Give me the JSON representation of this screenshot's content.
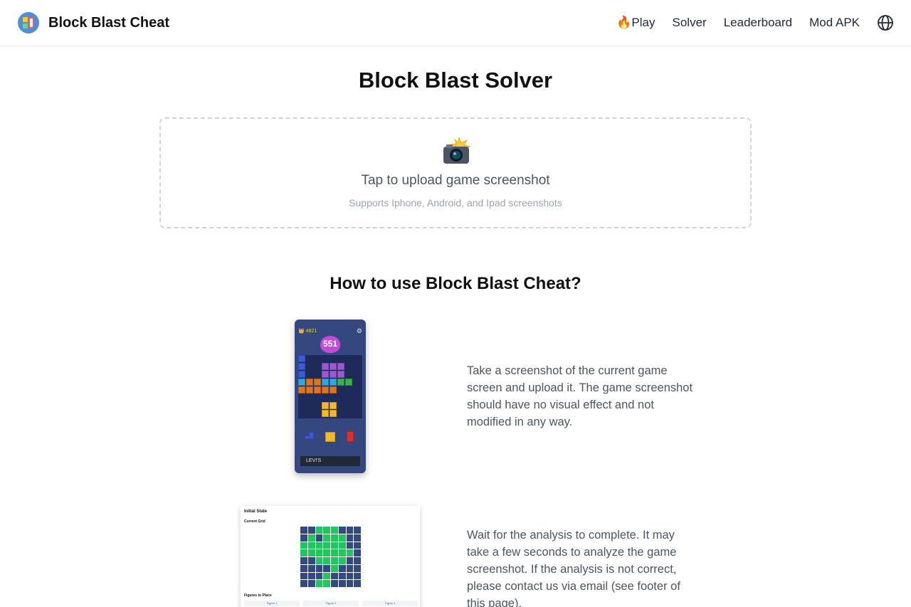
{
  "header": {
    "brand_name": "Block Blast Cheat",
    "nav": [
      {
        "label": "🔥Play"
      },
      {
        "label": "Solver"
      },
      {
        "label": "Leaderboard"
      },
      {
        "label": "Mod APK"
      }
    ],
    "language_icon": "globe-icon"
  },
  "main": {
    "title": "Block Blast Solver",
    "upload": {
      "icon": "camera-flash-icon",
      "title": "Tap to upload game screenshot",
      "subtitle": "Supports Iphone, Android, and Ipad screenshots"
    },
    "howto": {
      "title": "How to use Block Blast Cheat?",
      "steps": [
        {
          "text": "Take a screenshot of the current game screen and upload it. The game screenshot should have no visual effect and not modified in any way.",
          "image": {
            "score": "4821",
            "combo": "551",
            "ad_text": "LEVI'S"
          }
        },
        {
          "text": "Wait for the analysis to complete. It may take a few seconds to analyze the game screenshot. If the analysis is not correct, please contact us via email (see footer of this page).",
          "image": {
            "heading": "Initial State",
            "grid_label": "Current Grid",
            "figures_label": "Figures to Place",
            "figures": [
              "Figure 1",
              "Figure 2",
              "Figure 3"
            ]
          }
        }
      ]
    }
  },
  "colors": {
    "grid_filled": "#22c55e",
    "grid_empty": "#334a80",
    "text_muted": "#4b5563",
    "border_dashed": "#d1d5db"
  }
}
